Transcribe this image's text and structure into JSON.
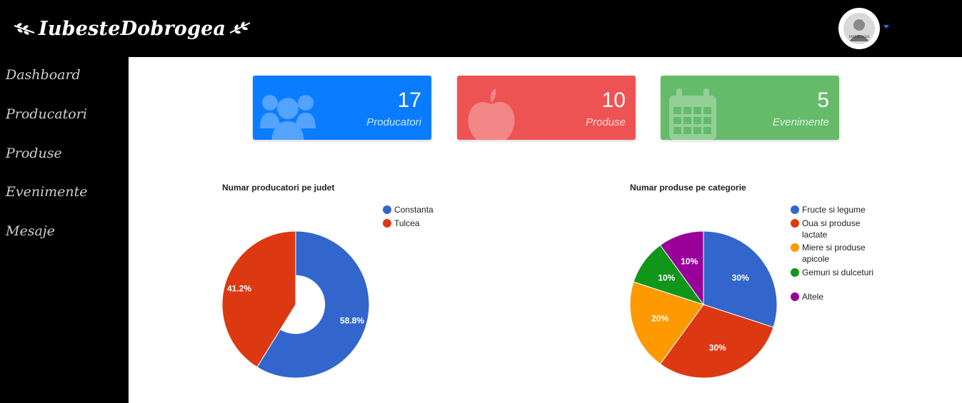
{
  "brand": {
    "name": "IubesteDobrogea"
  },
  "user": {
    "avatar_caption": "FADA DRAGOS"
  },
  "sidebar": {
    "items": [
      {
        "label": "Dashboard"
      },
      {
        "label": "Producatori"
      },
      {
        "label": "Produse"
      },
      {
        "label": "Evenimente"
      },
      {
        "label": "Mesaje"
      }
    ]
  },
  "cards": [
    {
      "value": "17",
      "label": "Producatori",
      "color": "#0a7cff",
      "icon": "users-icon"
    },
    {
      "value": "10",
      "label": "Produse",
      "color": "#ee5353",
      "icon": "apple-icon"
    },
    {
      "value": "5",
      "label": "Evenimente",
      "color": "#65bb6a",
      "icon": "calendar-icon"
    }
  ],
  "chart_data": [
    {
      "type": "pie",
      "donut": true,
      "title": "Numar producatori pe judet",
      "categories": [
        "Constanta",
        "Tulcea"
      ],
      "values": [
        58.8,
        41.2
      ],
      "labels": [
        "58.8%",
        "41.2%"
      ],
      "colors": [
        "#3366cc",
        "#dc3912"
      ],
      "legend": "top-right"
    },
    {
      "type": "pie",
      "donut": false,
      "title": "Numar produse pe categorie",
      "categories": [
        "Fructe si legume",
        "Oua si produse lactate",
        "Miere si produse apicole",
        "Gemuri si dulceturi",
        "Altele"
      ],
      "values": [
        30,
        30,
        20,
        10,
        10
      ],
      "labels": [
        "30%",
        "30%",
        "20%",
        "10%",
        "10%"
      ],
      "colors": [
        "#3366cc",
        "#dc3912",
        "#ff9900",
        "#109618",
        "#990099"
      ],
      "legend": "top-right"
    }
  ]
}
